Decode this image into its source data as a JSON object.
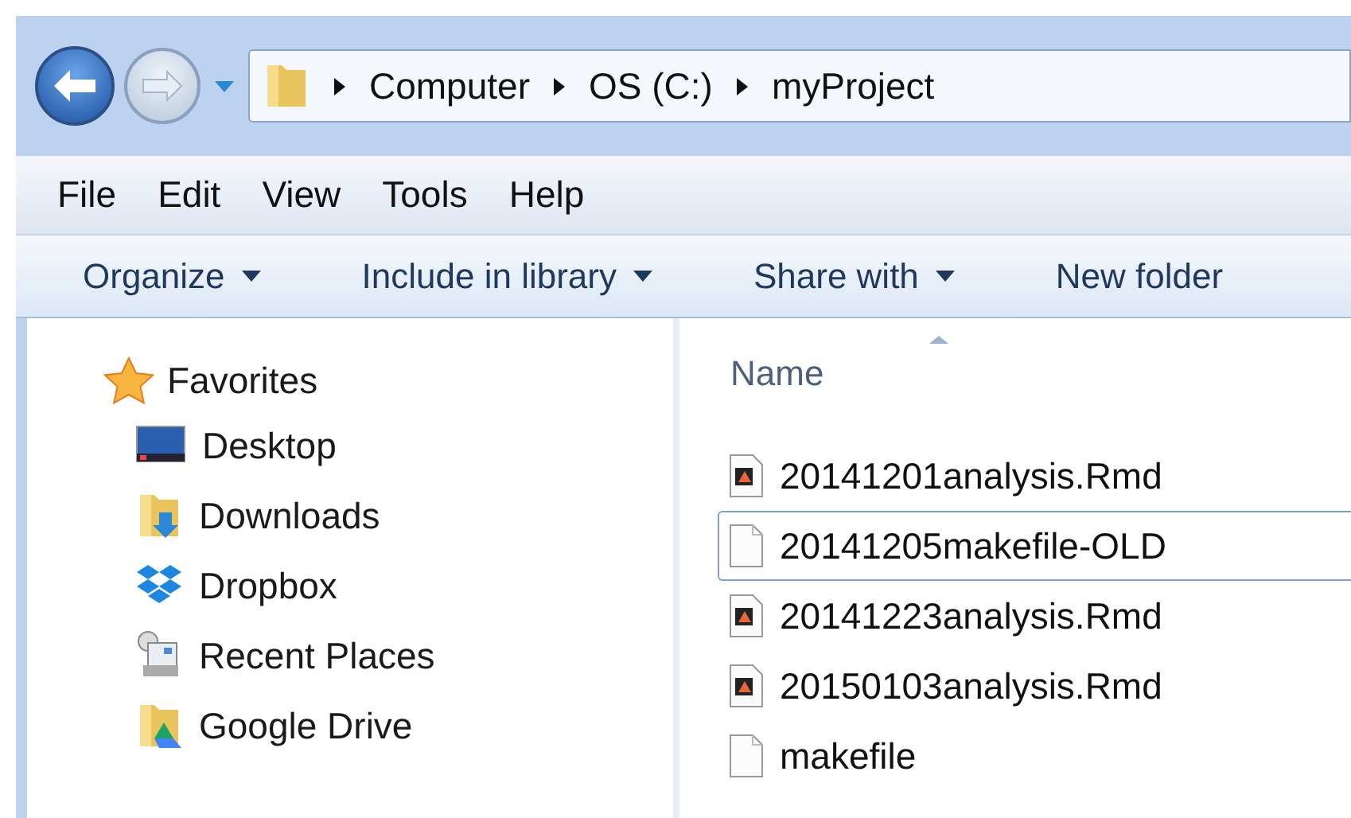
{
  "address_bar": {
    "path": [
      "Computer",
      "OS (C:)",
      "myProject"
    ]
  },
  "menu_bar": [
    "File",
    "Edit",
    "View",
    "Tools",
    "Help"
  ],
  "toolbar": [
    {
      "label": "Organize",
      "dropdown": true
    },
    {
      "label": "Include in library",
      "dropdown": true
    },
    {
      "label": "Share with",
      "dropdown": true
    },
    {
      "label": "New folder",
      "dropdown": false
    }
  ],
  "navigation_pane": {
    "heading": "Favorites",
    "items": [
      {
        "label": "Desktop",
        "kind": "desktop"
      },
      {
        "label": "Downloads",
        "kind": "downloads"
      },
      {
        "label": "Dropbox",
        "kind": "dropbox"
      },
      {
        "label": "Recent Places",
        "kind": "recent"
      },
      {
        "label": "Google Drive",
        "kind": "gdrive"
      }
    ]
  },
  "file_list": {
    "column": "Name",
    "files": [
      {
        "name": "20141201analysis.Rmd",
        "kind": "rmd",
        "focused": false
      },
      {
        "name": "20141205makefile-OLD",
        "kind": "plain",
        "focused": true
      },
      {
        "name": "20141223analysis.Rmd",
        "kind": "rmd",
        "focused": false
      },
      {
        "name": "20150103analysis.Rmd",
        "kind": "rmd",
        "focused": false
      },
      {
        "name": "makefile",
        "kind": "plain",
        "focused": false
      }
    ]
  }
}
